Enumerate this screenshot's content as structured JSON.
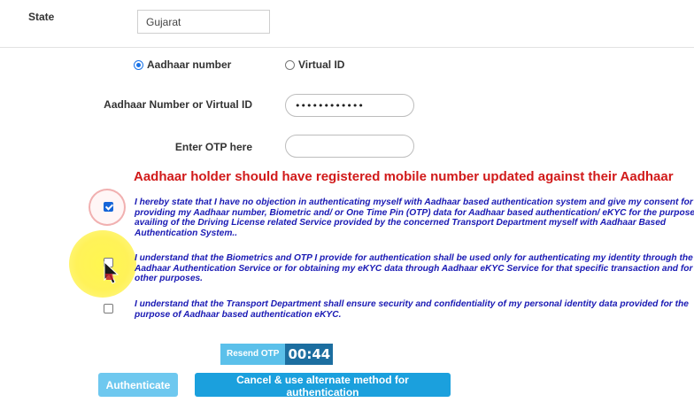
{
  "state": {
    "label": "State",
    "value": "Gujarat"
  },
  "id_type": {
    "options": [
      {
        "label": "Aadhaar number",
        "selected": true
      },
      {
        "label": "Virtual ID",
        "selected": false
      }
    ]
  },
  "aadhaar_field": {
    "label": "Aadhaar Number or Virtual ID",
    "value": "••••••••••••"
  },
  "otp_field": {
    "label": "Enter OTP here",
    "value": ""
  },
  "warning": "Aadhaar holder should have registered mobile number updated against their Aadhaar",
  "consents": [
    {
      "checked": true,
      "text": "I hereby state that I have no objection in authenticating myself with Aadhaar based authentication system and give my consent for providing my Aadhaar number, Biometric and/ or One Time Pin (OTP) data for Aadhaar based authentication/ eKYC for the purpose of availing of the Driving License related Service provided by the concerned Transport Department myself with Aadhaar Based Authentication System.."
    },
    {
      "checked": false,
      "text": "I understand that the Biometrics and OTP I provide for authentication shall be used only for authenticating my identity through the Aadhaar Authentication Service or for obtaining my eKYC data through Aadhaar eKYC Service for that specific transaction and for no other purposes."
    },
    {
      "checked": false,
      "text": "I understand that the Transport Department shall ensure security and confidentiality of my personal identity data provided for the purpose of Aadhaar based authentication eKYC."
    }
  ],
  "otp_timer": {
    "resend_label": "Resend OTP",
    "time": "00:44"
  },
  "actions": {
    "authenticate_label": "Authenticate",
    "cancel_label": "Cancel & use alternate method for authentication"
  },
  "colors": {
    "warning": "#d11a1a",
    "consent_text": "#1a1ab4",
    "primary_button": "#1ba0dd",
    "disabled_button": "#6ec8ef",
    "timer_bg": "#1c6ea0",
    "resend_bg": "#5bc0ea"
  }
}
